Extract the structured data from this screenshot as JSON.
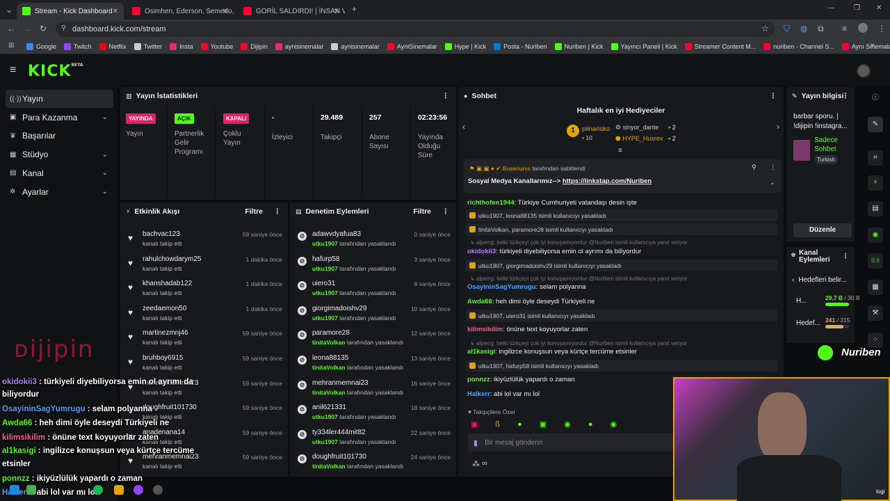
{
  "browser": {
    "tabs": [
      {
        "title": "Stream - Kick Dashboard",
        "color": "#53fc18"
      },
      {
        "title": "Osimhen, Ederson, Semedo, Br...",
        "color": "#ff0033"
      },
      {
        "title": "GORİL SALDIRDI! | İNSAN VAH...",
        "color": "#ff0033"
      }
    ],
    "new_tab": "+",
    "url": "dashboard.kick.com/stream",
    "bookmarks": [
      {
        "label": "Google",
        "color": "#4285f4"
      },
      {
        "label": "Twitch",
        "color": "#9146ff"
      },
      {
        "label": "Netflix",
        "color": "#e50914"
      },
      {
        "label": "Twitter",
        "color": "#cccccc"
      },
      {
        "label": "Insta",
        "color": "#e1306c"
      },
      {
        "label": "Youtube",
        "color": "#ff0033"
      },
      {
        "label": "Dijipin",
        "color": "#ff0033"
      },
      {
        "label": "aynisinemalar",
        "color": "#e1306c"
      },
      {
        "label": "aynisinemalar",
        "color": "#cccccc"
      },
      {
        "label": "AyniSinemalar",
        "color": "#ff0033"
      },
      {
        "label": "Hype | Kick",
        "color": "#53fc18"
      },
      {
        "label": "Posta - Nuriben",
        "color": "#0078d4"
      },
      {
        "label": "Nuriben | Kick",
        "color": "#53fc18"
      },
      {
        "label": "Yayıncı Paneli | Kick",
        "color": "#53fc18"
      },
      {
        "label": "Streamer Content M...",
        "color": "#ff0033"
      },
      {
        "label": "nuriben - Channel S...",
        "color": "#ff0033"
      },
      {
        "label": "Aynı Sinemalar - Ça...",
        "color": "#ff0033"
      }
    ]
  },
  "app": {
    "logo": "KICK",
    "logo_beta": "BETA",
    "nav": [
      {
        "label": "Yayın",
        "icon": "broadcast-icon",
        "active": true,
        "chevron": false
      },
      {
        "label": "Para Kazanma",
        "icon": "wallet-icon",
        "active": false,
        "chevron": true
      },
      {
        "label": "Başarılar",
        "icon": "trophy-icon",
        "active": false,
        "chevron": false
      },
      {
        "label": "Stüdyo",
        "icon": "studio-icon",
        "active": false,
        "chevron": true
      },
      {
        "label": "Kanal",
        "icon": "channel-icon",
        "active": false,
        "chevron": true
      },
      {
        "label": "Ayarlar",
        "icon": "gear-icon",
        "active": false,
        "chevron": true
      }
    ]
  },
  "stats": {
    "title": "Yayın İstatistikleri",
    "items": [
      {
        "value": "YAYINDA",
        "label": "Yayın",
        "badge": true,
        "color": "#e91e63"
      },
      {
        "value": "AÇIK",
        "label": "Partnerlik Gelir Programı",
        "badge": true,
        "color": "#53fc18"
      },
      {
        "value": "KAPALI",
        "label": "Çoklu Yayın",
        "badge": true,
        "color": "#e91e63"
      },
      {
        "value": "-",
        "label": "İzleyici",
        "badge": false
      },
      {
        "value": "29.489",
        "label": "Takipçi",
        "badge": false
      },
      {
        "value": "257",
        "label": "Abone Sayısı",
        "badge": false
      },
      {
        "value": "02:23:56",
        "label": "Yayında Olduğu Süre",
        "badge": false
      }
    ]
  },
  "activity": {
    "title": "Etkinlik Akışı",
    "filter": "Filtre",
    "rows": [
      {
        "name": "bachvac123",
        "action": "kanalı takip etti",
        "time": "59 saniye önce"
      },
      {
        "name": "rahulchowdarym25",
        "action": "kanalı takip etti",
        "time": "1 dakika önce"
      },
      {
        "name": "khanshadab122",
        "action": "kanalı takip etti",
        "time": "1 dakika önce"
      },
      {
        "name": "zeedaemon50",
        "action": "kanalı takip etti",
        "time": "1 dakika önce"
      },
      {
        "name": "martinezmnj46",
        "action": "kanalı takip etti",
        "time": "59 saniye önce"
      },
      {
        "name": "bruhboy6915",
        "action": "kanalı takip etti",
        "time": "59 saniye önce"
      },
      {
        "name": "mehranmemnai23",
        "action": "kanalı takip etti",
        "time": "59 saniye önce"
      },
      {
        "name": "doughfruit101730",
        "action": "kanalı takip etti",
        "time": "59 saniye önce"
      },
      {
        "name": "anadenana14",
        "action": "kanalı takip etti",
        "time": "59 saniye önce"
      },
      {
        "name": "mehranmemnai23",
        "action": "kanalı takip etti",
        "time": "59 saniye önce"
      }
    ]
  },
  "moderation": {
    "title": "Denetim Eylemleri",
    "filter": "Filtre",
    "suffix": "tarafından yasaklandı",
    "rows": [
      {
        "name": "adawvdyafua83",
        "by": "utku1907",
        "time": "0 saniye önce"
      },
      {
        "name": "hafurp58",
        "by": "utku1907",
        "time": "3 saniye önce"
      },
      {
        "name": "uiero31",
        "by": "utku1907",
        "time": "6 saniye önce"
      },
      {
        "name": "giorgimadoishv29",
        "by": "utku1907",
        "time": "10 saniye önce"
      },
      {
        "name": "paramore28",
        "by": "tinitaVolkan",
        "time": "12 saniye önce"
      },
      {
        "name": "leona88135",
        "by": "tinitaVolkan",
        "time": "13 saniye önce"
      },
      {
        "name": "mehranmemnai23",
        "by": "tinitaVolkan",
        "time": "16 saniye önce"
      },
      {
        "name": "anil621331",
        "by": "utku1907",
        "time": "18 saniye önce"
      },
      {
        "name": "ty334ler444mit82",
        "by": "utku1907",
        "time": "22 saniye önce"
      },
      {
        "name": "doughfruit101730",
        "by": "tinitaVolkan",
        "time": "24 saniye önce"
      }
    ]
  },
  "chat": {
    "title": "Sohbet",
    "gifters_title": "Haftalık en iyi Hediyeciler",
    "gifters": [
      {
        "rank": "1",
        "name": "piinarisko",
        "count": "10"
      },
      {
        "name": "sinyor_dante",
        "count": "2"
      },
      {
        "name": "HYPE_Husrev",
        "count": "2"
      }
    ],
    "pinned_by": "Busenurss",
    "pinned_suffix": "tarafından sabitlendi",
    "pinned_text": "Sosyal Medya Kanallarımız-->",
    "pinned_link": "https://linkstap.com/Nuriben",
    "followers_special": "Takipçilere Özel",
    "placeholder": "Bir mesaj gönderin",
    "messages": [
      {
        "kind": "msg",
        "user": "richthofen1944",
        "color": "#53fc18",
        "text": "Türkiye Cumhuriyeti vatandaşı desin işte"
      },
      {
        "kind": "mod",
        "text": "utku1907, leona88135 isimli kullanıcıyı yasakladı"
      },
      {
        "kind": "mod",
        "text": "tinitaVolkan, paramore28 isimli kullanıcıyı yasakladı"
      },
      {
        "kind": "reply",
        "text": "alperrg: belki türkçeyi çok iyi konuşamıyordur @Nuriben isimli kullanıcıya yanıt veriyor"
      },
      {
        "kind": "msg",
        "user": "okidokii3",
        "color": "#b57cff",
        "text": "türkiyeli diyebiliyorsa emin ol ayrımı da biliyordur"
      },
      {
        "kind": "mod",
        "text": "utku1907, giorgimadoishv29 isimli kullanıcıyı yasakladı"
      },
      {
        "kind": "reply",
        "text": "alperrg: belki türkçeyi çok iyi konuşamıyordur @Nuriben isimli kullanıcıya yanıt veriyor"
      },
      {
        "kind": "msg",
        "user": "OsayininSagYumrugu",
        "color": "#4da3ff",
        "text": "selam polyanna"
      },
      {
        "kind": "msg",
        "user": "Awda66",
        "color": "#53fc18",
        "text": "heh dimi öyle deseydi Türkiyeli ne"
      },
      {
        "kind": "mod",
        "text": "utku1907, uiero31 isimli kullanıcıyı yasakladı"
      },
      {
        "kind": "msg",
        "user": "kilimsikilim",
        "color": "#ff5c8a",
        "text": "önüne text koyuyorlar zaten"
      },
      {
        "kind": "reply",
        "text": "alperrg: belki türkçeyi çok iyi konuşamıyordur @Nuriben isimli kullanıcıya yanıt veriyor"
      },
      {
        "kind": "msg",
        "user": "al1kasigi",
        "color": "#53fc18",
        "text": "ingilizce konuşsun veya kürtçe tercüme etsinler"
      },
      {
        "kind": "mod",
        "text": "utku1907, hafurp58 isimli kullanıcıyı yasakladı"
      },
      {
        "kind": "msg",
        "user": "ponnzz",
        "color": "#53fc18",
        "text": "ikiyüzlülük yapardı o zaman"
      },
      {
        "kind": "msg",
        "user": "Halkerr",
        "color": "#4da3ff",
        "text": "abi lol var mı lol"
      }
    ]
  },
  "info": {
    "title": "Yayın bilgisi",
    "stream_title": "barbar sporu. | !dijipin !instagra...",
    "mode": "Sadece Sohbet",
    "language": "Turkish",
    "edit": "Düzenle",
    "channel_actions": "Kanal Eylemleri",
    "goals_title": "Hedefleri belir...",
    "goals": [
      {
        "label": "H...",
        "value": "29,7 B",
        "total": "/ 30 B",
        "progress": 0.99,
        "color": "#53fc18"
      },
      {
        "label": "Hedef...",
        "value": "241",
        "total": "/ 315",
        "progress": 0.77,
        "color": "#e0b050"
      }
    ]
  },
  "overlay": {
    "brand": "Nuriben",
    "dijipin": "Dijipin",
    "cam_label": "logi",
    "chat": [
      {
        "user": "okidokii3",
        "color": "#b57cff",
        "text": "türkiyeli diyebiliyorsa emin ol ayrımı da"
      },
      {
        "user": "",
        "color": "#ffffff",
        "text": "biliyordur"
      },
      {
        "user": "OsayininSagYumrugu",
        "color": "#4da3ff",
        "text": "selam polyanna"
      },
      {
        "user": "Awda66",
        "color": "#53fc18",
        "text": "heh dimi öyle deseydi Türkiyeli ne"
      },
      {
        "user": "kilimsikilim",
        "color": "#ff5c8a",
        "text": "önüne text koyuyorlar zaten"
      },
      {
        "user": "al1kasigi",
        "color": "#53fc18",
        "text": "ingilizce konuşsun veya kürtçe tercüme"
      },
      {
        "user": "",
        "color": "#ffffff",
        "text": "etsinler"
      },
      {
        "user": "ponnzz",
        "color": "#53fc18",
        "text": "ikiyüzlülük yapardı o zaman"
      },
      {
        "user": "Halkerr",
        "color": "#4da3ff",
        "text": "abi lol var mı lol"
      }
    ]
  }
}
